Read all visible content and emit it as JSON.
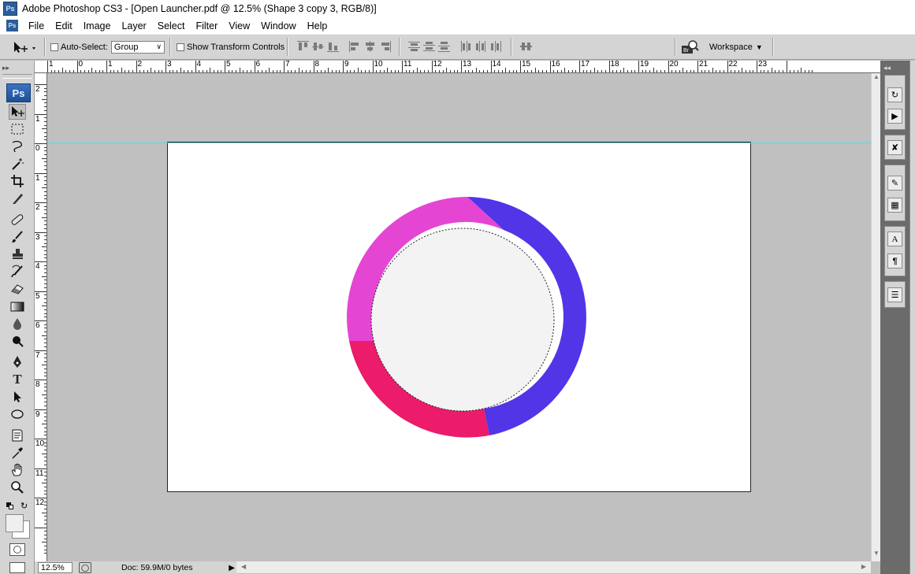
{
  "window": {
    "title": "Adobe Photoshop CS3 - [Open Launcher.pdf @ 12.5% (Shape 3 copy 3, RGB/8)]",
    "app_icon_text": "Ps"
  },
  "menu": {
    "items": [
      "File",
      "Edit",
      "Image",
      "Layer",
      "Select",
      "Filter",
      "View",
      "Window",
      "Help"
    ]
  },
  "options_bar": {
    "auto_select_label": "Auto-Select:",
    "auto_select_value": "Group",
    "show_transform_label": "Show Transform Controls",
    "workspace_label": "Workspace"
  },
  "toolbar": {
    "logo": "Ps",
    "tools": [
      "move-tool",
      "marquee-tool",
      "lasso-tool",
      "magic-wand-tool",
      "crop-tool",
      "slice-tool",
      "healing-brush-tool",
      "brush-tool",
      "clone-stamp-tool",
      "history-brush-tool",
      "eraser-tool",
      "gradient-tool",
      "blur-tool",
      "dodge-tool",
      "pen-tool",
      "type-tool",
      "path-selection-tool",
      "ellipse-tool",
      "notes-tool",
      "eyedropper-tool",
      "hand-tool",
      "zoom-tool"
    ]
  },
  "rulers": {
    "horizontal_labels": [
      "1",
      "0",
      "1",
      "2",
      "3",
      "4",
      "5",
      "6",
      "7",
      "8",
      "9",
      "10",
      "11",
      "12",
      "13",
      "14",
      "15",
      "16",
      "17",
      "18",
      "19",
      "20",
      "21",
      "22",
      "23"
    ],
    "vertical_labels": [
      "2",
      "1",
      "0",
      "1",
      "2",
      "3",
      "4",
      "5",
      "6",
      "7",
      "8",
      "9",
      "10",
      "11",
      "12"
    ]
  },
  "status_bar": {
    "zoom": "12.5%",
    "doc_info": "Doc: 59.9M/0 bytes"
  },
  "colors": {
    "ring_pink": "#e446d3",
    "ring_blue": "#5135e6",
    "ring_red": "#ec1b6b",
    "ring_center": "#f3f3f3",
    "guide": "#5fd6d6",
    "pasteboard": "#c0c0c0"
  }
}
